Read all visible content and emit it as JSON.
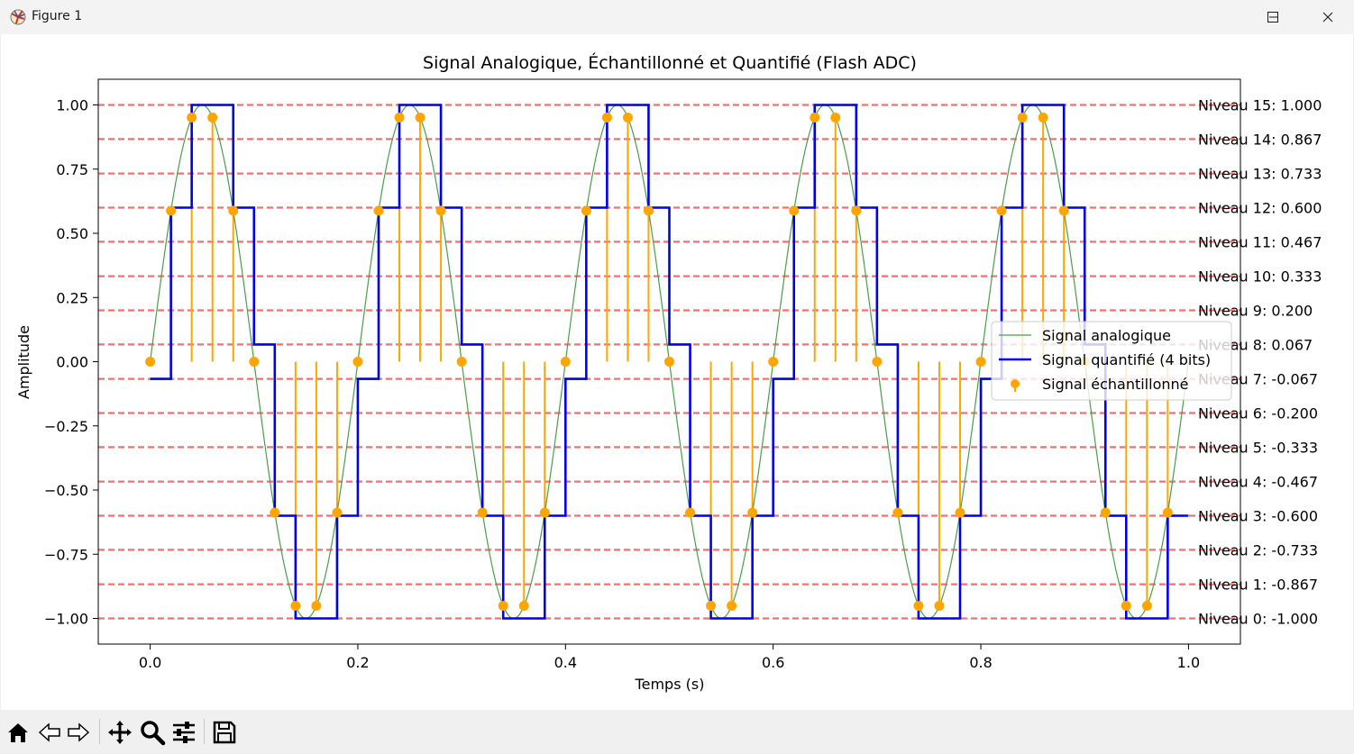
{
  "window": {
    "title": "Figure 1"
  },
  "toolbar": {
    "items": [
      "home-icon",
      "back-icon",
      "forward-icon",
      "pan-icon",
      "zoom-icon",
      "configure-icon",
      "save-icon"
    ]
  },
  "colors": {
    "analog": "#4a9e4a",
    "quantized": "#0000ee",
    "sampled": "#ffa500",
    "levels": "#ee4444"
  },
  "chart_data": {
    "type": "line",
    "title": "Signal Analogique, Échantillonné et Quantifié (Flash ADC)",
    "xlabel": "Temps (s)",
    "ylabel": "Amplitude",
    "xlim": [
      -0.05,
      1.05
    ],
    "ylim": [
      -1.1,
      1.1
    ],
    "xticks": [
      0.0,
      0.2,
      0.4,
      0.6,
      0.8,
      1.0
    ],
    "xtick_labels": [
      "0.0",
      "0.2",
      "0.4",
      "0.6",
      "0.8",
      "1.0"
    ],
    "yticks": [
      -1.0,
      -0.75,
      -0.5,
      -0.25,
      0.0,
      0.25,
      0.5,
      0.75,
      1.0
    ],
    "ytick_labels": [
      "−1.00",
      "−0.75",
      "−0.50",
      "−0.25",
      "0.00",
      "0.25",
      "0.50",
      "0.75",
      "1.00"
    ],
    "signal_frequency_hz": 5,
    "sampling_period_s": 0.02,
    "analog_amplitude": 1.0,
    "grid": false,
    "legend_position": "center-right",
    "legend": [
      "Signal analogique",
      "Signal quantifié (4 bits)",
      "Signal échantillonné"
    ],
    "quantization_levels": [
      -1.0,
      -0.867,
      -0.733,
      -0.6,
      -0.467,
      -0.333,
      -0.2,
      -0.067,
      0.067,
      0.2,
      0.333,
      0.467,
      0.6,
      0.733,
      0.867,
      1.0
    ],
    "level_labels": [
      "Niveau 0: -1.000",
      "Niveau 1: -0.867",
      "Niveau 2: -0.733",
      "Niveau 3: -0.600",
      "Niveau 4: -0.467",
      "Niveau 5: -0.333",
      "Niveau 6: -0.200",
      "Niveau 7: -0.067",
      "Niveau 8: 0.067",
      "Niveau 9: 0.200",
      "Niveau 10: 0.333",
      "Niveau 11: 0.467",
      "Niveau 12: 0.600",
      "Niveau 13: 0.733",
      "Niveau 14: 0.867",
      "Niveau 15: 1.000"
    ],
    "series": [
      {
        "name": "Signal échantillonné",
        "x": [
          0.0,
          0.02,
          0.04,
          0.06,
          0.08,
          0.1,
          0.12,
          0.14,
          0.16,
          0.18,
          0.2,
          0.22,
          0.24,
          0.26,
          0.28,
          0.3,
          0.32,
          0.34,
          0.36,
          0.38,
          0.4,
          0.42,
          0.44,
          0.46,
          0.48,
          0.5,
          0.52,
          0.54,
          0.56,
          0.58,
          0.6,
          0.62,
          0.64,
          0.66,
          0.68,
          0.7,
          0.72,
          0.74,
          0.76,
          0.78,
          0.8,
          0.82,
          0.84,
          0.86,
          0.88,
          0.9,
          0.92,
          0.94,
          0.96,
          0.98
        ],
        "y": [
          0.0,
          0.588,
          0.951,
          0.951,
          0.588,
          0.0,
          -0.588,
          -0.951,
          -0.951,
          -0.588,
          0.0,
          0.588,
          0.951,
          0.951,
          0.588,
          0.0,
          -0.588,
          -0.951,
          -0.951,
          -0.588,
          0.0,
          0.588,
          0.951,
          0.951,
          0.588,
          0.0,
          -0.588,
          -0.951,
          -0.951,
          -0.588,
          0.0,
          0.588,
          0.951,
          0.951,
          0.588,
          0.0,
          -0.588,
          -0.951,
          -0.951,
          -0.588,
          0.0,
          0.588,
          0.951,
          0.951,
          0.588,
          0.0,
          -0.588,
          -0.951,
          -0.951,
          -0.588
        ]
      },
      {
        "name": "Signal quantifié (4 bits)",
        "x": [
          0.0,
          0.02,
          0.04,
          0.06,
          0.08,
          0.1,
          0.12,
          0.14,
          0.16,
          0.18,
          0.2,
          0.22,
          0.24,
          0.26,
          0.28,
          0.3,
          0.32,
          0.34,
          0.36,
          0.38,
          0.4,
          0.42,
          0.44,
          0.46,
          0.48,
          0.5,
          0.52,
          0.54,
          0.56,
          0.58,
          0.6,
          0.62,
          0.64,
          0.66,
          0.68,
          0.7,
          0.72,
          0.74,
          0.76,
          0.78,
          0.8,
          0.82,
          0.84,
          0.86,
          0.88,
          0.9,
          0.92,
          0.94,
          0.96,
          0.98
        ],
        "y": [
          -0.067,
          0.6,
          1.0,
          1.0,
          0.6,
          0.067,
          -0.6,
          -1.0,
          -1.0,
          -0.6,
          -0.067,
          0.6,
          1.0,
          1.0,
          0.6,
          0.067,
          -0.6,
          -1.0,
          -1.0,
          -0.6,
          -0.067,
          0.6,
          1.0,
          1.0,
          0.6,
          0.067,
          -0.6,
          -1.0,
          -1.0,
          -0.6,
          -0.067,
          0.6,
          1.0,
          1.0,
          0.6,
          0.067,
          -0.6,
          -1.0,
          -1.0,
          -0.6,
          -0.067,
          0.6,
          1.0,
          1.0,
          0.6,
          0.067,
          -0.6,
          -1.0,
          -1.0,
          -0.6
        ]
      }
    ]
  }
}
